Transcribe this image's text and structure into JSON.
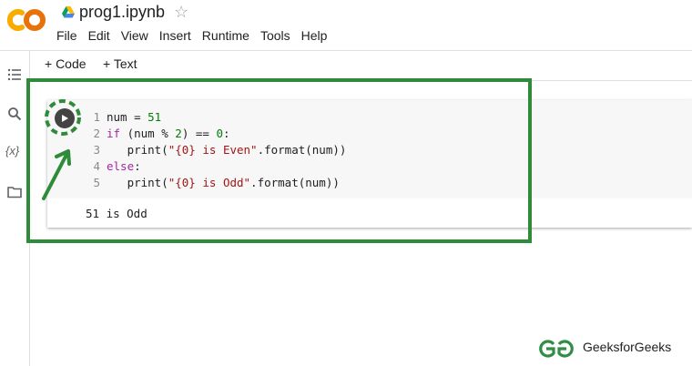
{
  "header": {
    "logo_text": "CO",
    "filename": "prog1.ipynb",
    "star_glyph": "☆",
    "menu": [
      "File",
      "Edit",
      "View",
      "Insert",
      "Runtime",
      "Tools",
      "Help"
    ]
  },
  "sidebar": {
    "icons": [
      "list-icon",
      "search-icon",
      "variables-icon",
      "folder-icon"
    ],
    "variables_label": "{x}"
  },
  "toolbar": {
    "add_code": "+ Code",
    "add_text": "+ Text"
  },
  "cell": {
    "line_numbers": [
      "1",
      "2",
      "3",
      "4",
      "5"
    ],
    "lines": [
      [
        {
          "t": "num = ",
          "c": ""
        },
        {
          "t": "51",
          "c": "num"
        }
      ],
      [
        {
          "t": "if",
          "c": "kw"
        },
        {
          "t": " (num % ",
          "c": ""
        },
        {
          "t": "2",
          "c": "num"
        },
        {
          "t": ") == ",
          "c": ""
        },
        {
          "t": "0",
          "c": "num"
        },
        {
          "t": ":",
          "c": ""
        }
      ],
      [
        {
          "t": "   print(",
          "c": ""
        },
        {
          "t": "\"{0} is Even\"",
          "c": "str"
        },
        {
          "t": ".format(num))",
          "c": ""
        }
      ],
      [
        {
          "t": "else",
          "c": "kw"
        },
        {
          "t": ":",
          "c": ""
        }
      ],
      [
        {
          "t": "   print(",
          "c": ""
        },
        {
          "t": "\"{0} is Odd\"",
          "c": "str"
        },
        {
          "t": ".format(num))",
          "c": ""
        }
      ]
    ],
    "output": "51 is Odd"
  },
  "watermark": {
    "text": "GeeksforGeeks",
    "color": "#2f8d46"
  },
  "colors": {
    "highlight": "#2e8b3a",
    "logo_orange": "#f9ab00",
    "logo_dark": "#e8710a"
  }
}
